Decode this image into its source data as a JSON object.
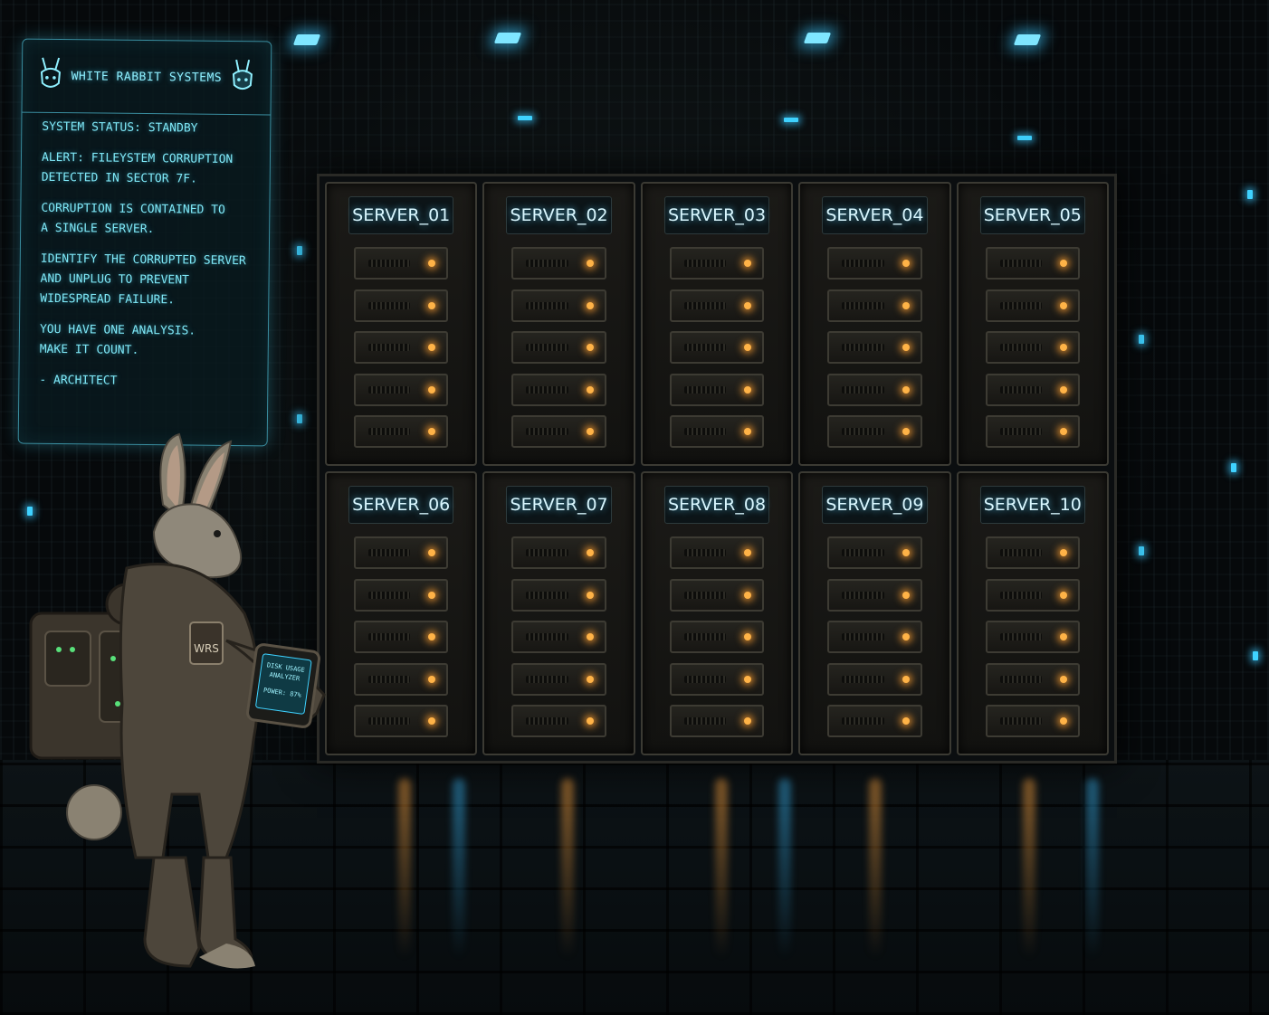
{
  "terminal": {
    "title": "WHITE RABBIT SYSTEMS",
    "lines": [
      "SYSTEM STATUS: STANDBY",
      "ALERT: FILEYSTEM CORRUPTION\nDETECTED IN SECTOR 7F.",
      "CORRUPTION IS CONTAINED TO\nA SINGLE SERVER.",
      "IDENTIFY THE CORRUPTED SERVER\nAND UNPLUG TO PREVENT\nWIDESPREAD FAILURE.",
      "YOU HAVE ONE ANALYSIS.\nMAKE IT COUNT.",
      "- ARCHITECT"
    ]
  },
  "servers": [
    {
      "label": "SERVER_01"
    },
    {
      "label": "SERVER_02"
    },
    {
      "label": "SERVER_03"
    },
    {
      "label": "SERVER_04"
    },
    {
      "label": "SERVER_05"
    },
    {
      "label": "SERVER_06"
    },
    {
      "label": "SERVER_07"
    },
    {
      "label": "SERVER_08"
    },
    {
      "label": "SERVER_09"
    },
    {
      "label": "SERVER_10"
    }
  ],
  "rabbit": {
    "patch_text": "WRS",
    "device_line1": "DISK USAGE",
    "device_line2": "ANALYZER",
    "device_line3": "POWER: 87%"
  },
  "colors": {
    "accent": "#7fe8f7",
    "led": "#ffb347",
    "glow": "#3fd2ff"
  }
}
